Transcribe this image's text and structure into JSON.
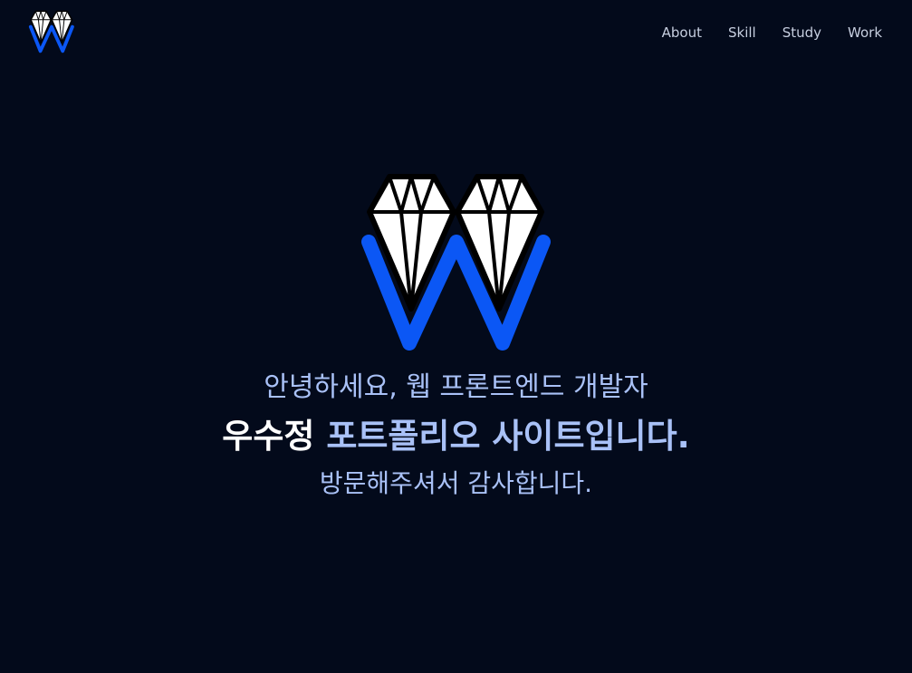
{
  "header": {
    "nav": [
      {
        "label": "About"
      },
      {
        "label": "Skill"
      },
      {
        "label": "Study"
      },
      {
        "label": "Work"
      }
    ]
  },
  "hero": {
    "greeting": "안녕하세요, 웹 프론트엔드 개발자",
    "name": "우수정",
    "title_rest": "포트폴리오 사이트입니다.",
    "thanks": "방문해주셔서 감사합니다."
  },
  "colors": {
    "background": "#030a1b",
    "accent_text": "#a9c1f7",
    "logo_blue": "#0b57f5",
    "nav_text": "#c7cfe0"
  },
  "icons": {
    "logo": "diamond-w-logo-icon"
  }
}
